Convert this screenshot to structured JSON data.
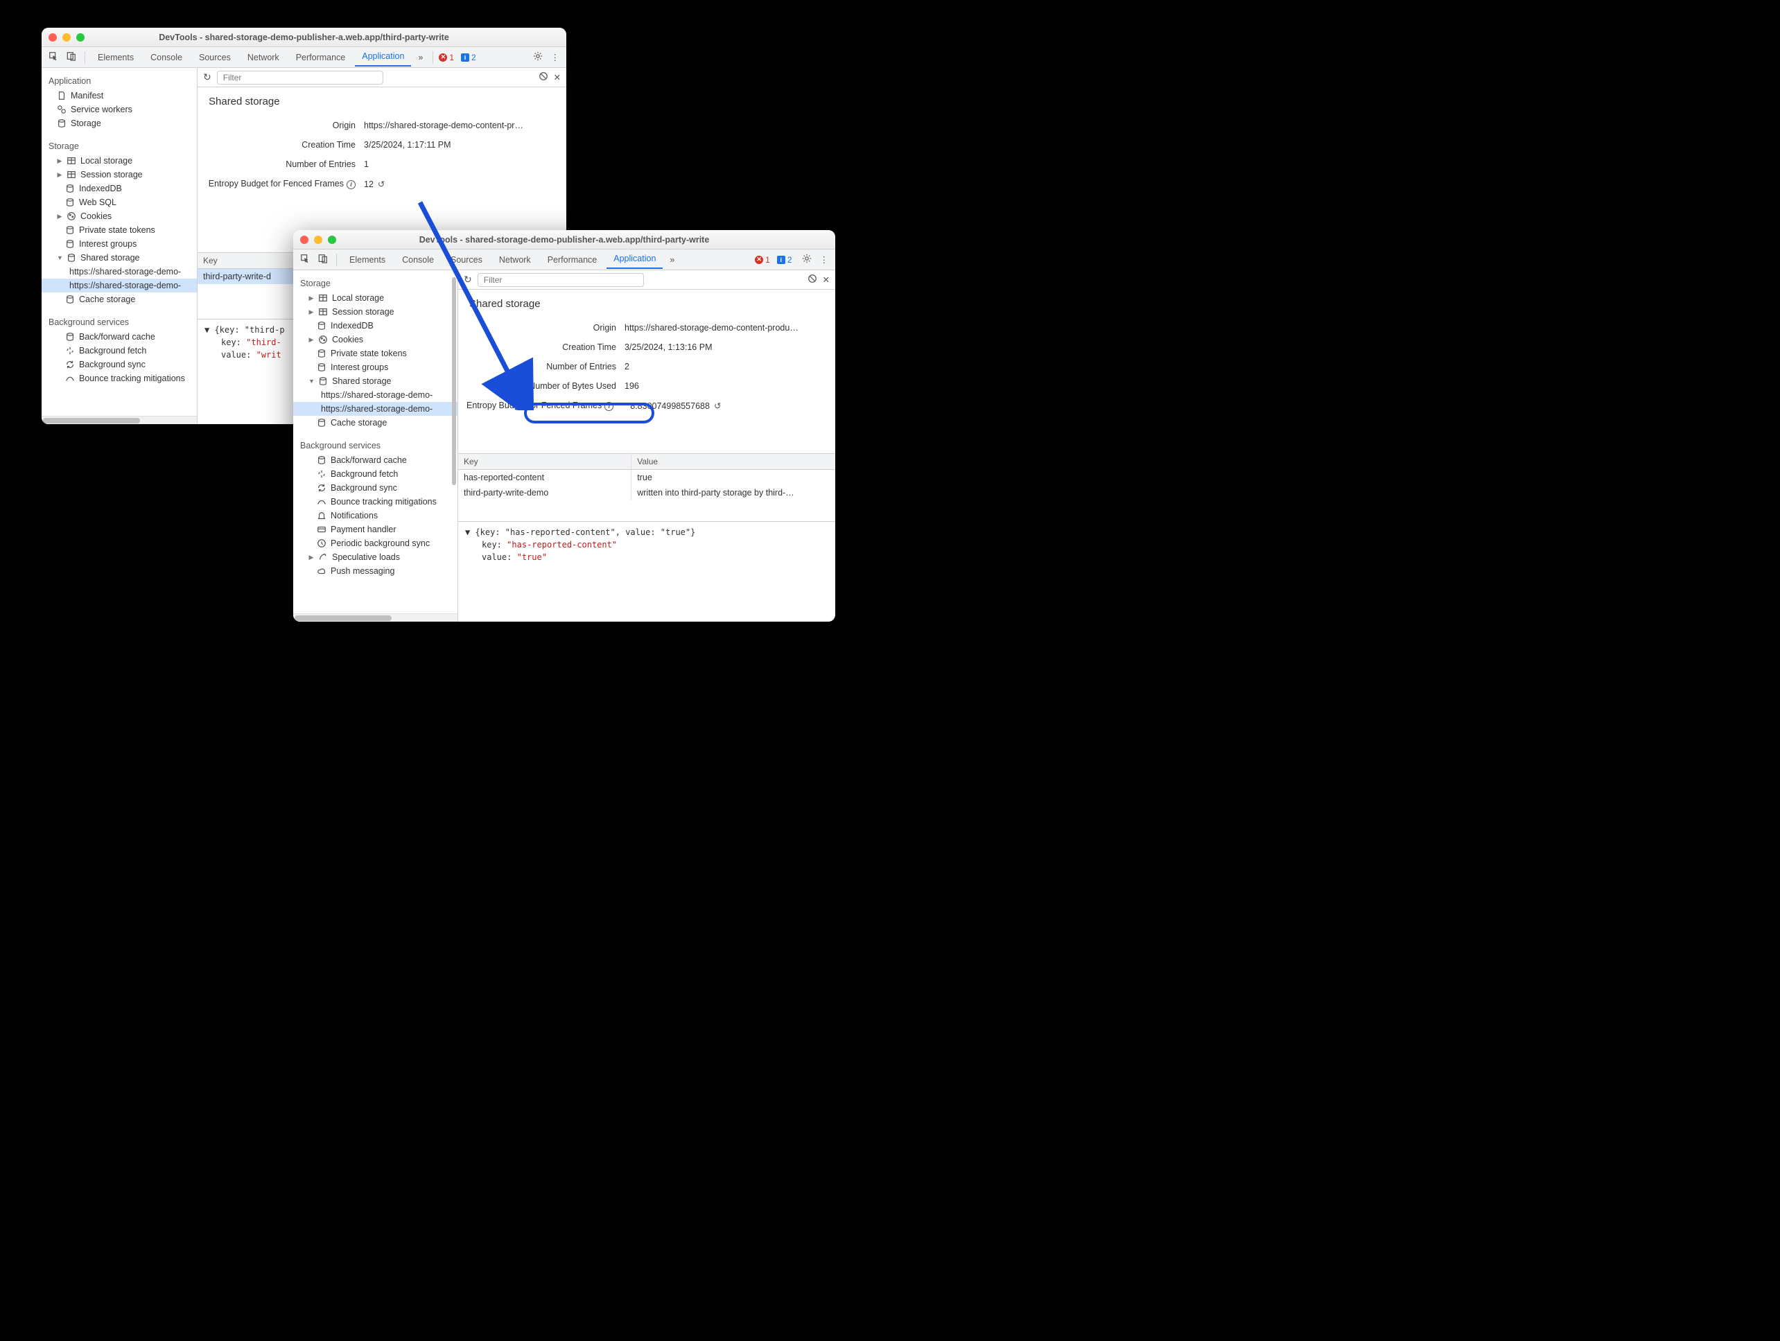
{
  "window1": {
    "title": "DevTools - shared-storage-demo-publisher-a.web.app/third-party-write",
    "tabs": [
      "Elements",
      "Console",
      "Sources",
      "Network",
      "Performance",
      "Application"
    ],
    "active_tab": "Application",
    "errors": "1",
    "infos": "2",
    "sidebar": {
      "application": {
        "title": "Application",
        "items": [
          "Manifest",
          "Service workers",
          "Storage"
        ]
      },
      "storage": {
        "title": "Storage",
        "items": [
          "Local storage",
          "Session storage",
          "IndexedDB",
          "Web SQL",
          "Cookies",
          "Private state tokens",
          "Interest groups"
        ],
        "shared_storage": {
          "label": "Shared storage",
          "origins": [
            "https://shared-storage-demo-",
            "https://shared-storage-demo-"
          ]
        },
        "cache": "Cache storage"
      },
      "bg": {
        "title": "Background services",
        "items": [
          "Back/forward cache",
          "Background fetch",
          "Background sync",
          "Bounce tracking mitigations"
        ]
      }
    },
    "filter_placeholder": "Filter",
    "panel_title": "Shared storage",
    "details": {
      "origin": {
        "label": "Origin",
        "value": "https://shared-storage-demo-content-pr…"
      },
      "created": {
        "label": "Creation Time",
        "value": "3/25/2024, 1:17:11 PM"
      },
      "entries": {
        "label": "Number of Entries",
        "value": "1"
      },
      "entropy": {
        "label": "Entropy Budget for Fenced Frames",
        "value": "12"
      }
    },
    "table": {
      "key_header": "Key",
      "key": "third-party-write-d"
    },
    "json": {
      "header": "{key: \"third-p",
      "k1": "key:",
      "v1": "\"third-",
      "k2": "value:",
      "v2": "\"writ"
    }
  },
  "window2": {
    "title": "DevTools - shared-storage-demo-publisher-a.web.app/third-party-write",
    "tabs": [
      "Elements",
      "Console",
      "Sources",
      "Network",
      "Performance",
      "Application"
    ],
    "active_tab": "Application",
    "errors": "1",
    "infos": "2",
    "sidebar": {
      "storage": {
        "title": "Storage",
        "items": [
          "Local storage",
          "Session storage",
          "IndexedDB",
          "Cookies",
          "Private state tokens",
          "Interest groups"
        ],
        "shared_storage": {
          "label": "Shared storage",
          "origins": [
            "https://shared-storage-demo-",
            "https://shared-storage-demo-"
          ]
        },
        "cache": "Cache storage"
      },
      "bg": {
        "title": "Background services",
        "items": [
          "Back/forward cache",
          "Background fetch",
          "Background sync",
          "Bounce tracking mitigations",
          "Notifications",
          "Payment handler",
          "Periodic background sync",
          "Speculative loads",
          "Push messaging"
        ]
      }
    },
    "filter_placeholder": "Filter",
    "panel_title": "Shared storage",
    "details": {
      "origin": {
        "label": "Origin",
        "value": "https://shared-storage-demo-content-produ…"
      },
      "created": {
        "label": "Creation Time",
        "value": "3/25/2024, 1:13:16 PM"
      },
      "entries": {
        "label": "Number of Entries",
        "value": "2"
      },
      "bytes": {
        "label": "Number of Bytes Used",
        "value": "196"
      },
      "entropy": {
        "label": "Entropy Budget for Fenced Frames",
        "value": "8.830074998557688"
      }
    },
    "table": {
      "headers": {
        "key": "Key",
        "value": "Value"
      },
      "rows": [
        {
          "key": "has-reported-content",
          "value": "true"
        },
        {
          "key": "third-party-write-demo",
          "value": "written into third-party storage by third-…"
        }
      ]
    },
    "json": {
      "header": "{key: \"has-reported-content\", value: \"true\"}",
      "k1": "key:",
      "v1": "\"has-reported-content\"",
      "k2": "value:",
      "v2": "\"true\""
    }
  }
}
